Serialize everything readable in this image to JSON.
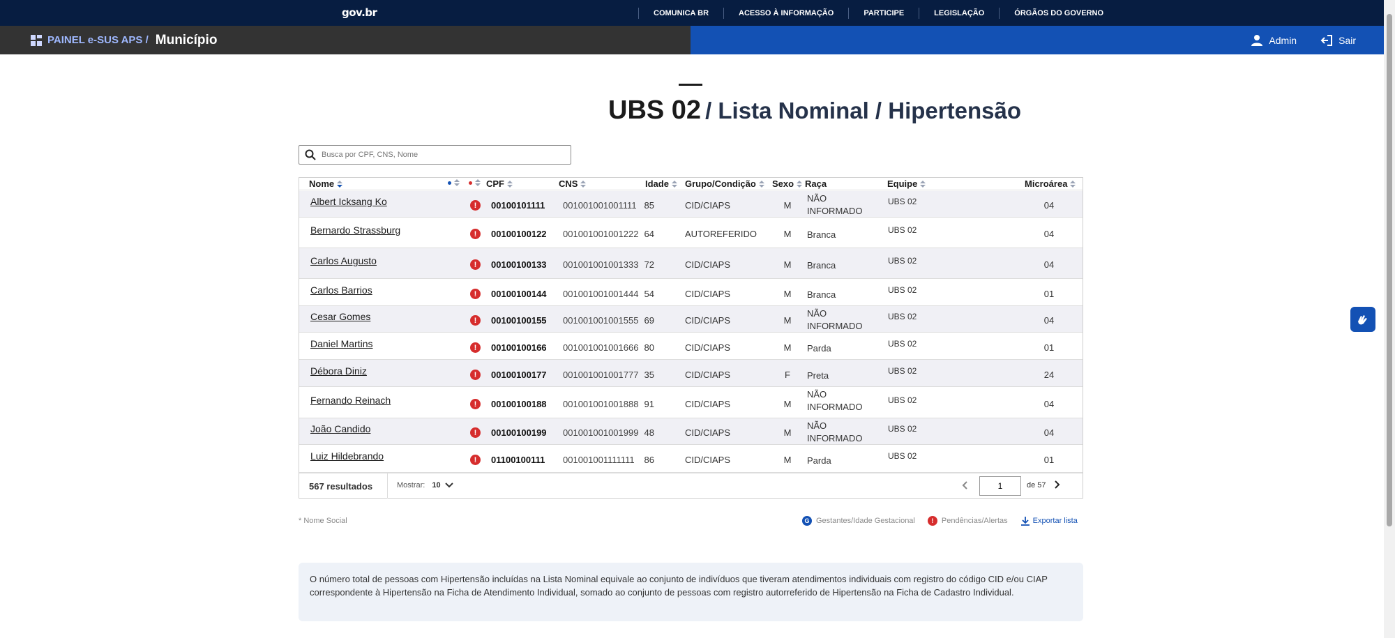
{
  "govbar": {
    "logo": "gov.br",
    "links": [
      "COMUNICA BR",
      "ACESSO À INFORMAÇÃO",
      "PARTICIPE",
      "LEGISLAÇÃO",
      "ÓRGÃOS DO GOVERNO"
    ]
  },
  "header": {
    "brand": "PAINEL e-SUS APS /",
    "city": "Município",
    "user_label": "Admin",
    "logout_label": "Sair"
  },
  "title": {
    "unit": "UBS 02",
    "subtitle": "/ Lista Nominal / Hipertensão"
  },
  "search": {
    "placeholder": "Busca por CPF, CNS, Nome"
  },
  "table": {
    "columns": {
      "name": "Nome",
      "cpf": "CPF",
      "cns": "CNS",
      "age": "Idade",
      "group": "Grupo/Condição",
      "sex": "Sexo",
      "race": "Raça",
      "team": "Equipe",
      "micro": "Microárea"
    },
    "alert_glyph": "!",
    "rows": [
      {
        "name": "Albert Icksang Ko",
        "cpf": "00100101111",
        "cns": "001001001001111",
        "age": "85",
        "group": "CID/CIAPS",
        "sex": "M",
        "race": "NÃO INFORMADO",
        "team": "UBS 02",
        "micro": "04"
      },
      {
        "name": "Bernardo Strassburg",
        "cpf": "00100100122",
        "cns": "001001001001222",
        "age": "64",
        "group": "AUTOREFERIDO",
        "sex": "M",
        "race": "Branca",
        "team": "UBS 02",
        "micro": "04"
      },
      {
        "name": "Carlos Augusto",
        "cpf": "00100100133",
        "cns": "001001001001333",
        "age": "72",
        "group": "CID/CIAPS",
        "sex": "M",
        "race": "Branca",
        "team": "UBS 02",
        "micro": "04"
      },
      {
        "name": "Carlos Barrios",
        "cpf": "00100100144",
        "cns": "001001001001444",
        "age": "54",
        "group": "CID/CIAPS",
        "sex": "M",
        "race": "Branca",
        "team": "UBS 02",
        "micro": "01"
      },
      {
        "name": "Cesar Gomes",
        "cpf": "00100100155",
        "cns": "001001001001555",
        "age": "69",
        "group": "CID/CIAPS",
        "sex": "M",
        "race": "NÃO INFORMADO",
        "team": "UBS 02",
        "micro": "04"
      },
      {
        "name": "Daniel Martins",
        "cpf": "00100100166",
        "cns": "001001001001666",
        "age": "80",
        "group": "CID/CIAPS",
        "sex": "M",
        "race": "Parda",
        "team": "UBS 02",
        "micro": "01"
      },
      {
        "name": "Débora Diniz",
        "cpf": "00100100177",
        "cns": "001001001001777",
        "age": "35",
        "group": "CID/CIAPS",
        "sex": "F",
        "race": "Preta",
        "team": "UBS 02",
        "micro": "24"
      },
      {
        "name": "Fernando Reinach",
        "cpf": "00100100188",
        "cns": "001001001001888",
        "age": "91",
        "group": "CID/CIAPS",
        "sex": "M",
        "race": "NÃO INFORMADO",
        "team": "UBS 02",
        "micro": "04"
      },
      {
        "name": "João Candido",
        "cpf": "00100100199",
        "cns": "001001001001999",
        "age": "48",
        "group": "CID/CIAPS",
        "sex": "M",
        "race": "NÃO INFORMADO",
        "team": "UBS 02",
        "micro": "04"
      },
      {
        "name": "Luiz Hildebrando",
        "cpf": "01100100111",
        "cns": "001001001111111",
        "age": "86",
        "group": "CID/CIAPS",
        "sex": "M",
        "race": "Parda",
        "team": "UBS 02",
        "micro": "01"
      }
    ]
  },
  "footer": {
    "results": "567 resultados",
    "show_label": "Mostrar:",
    "show_value": "10",
    "page_value": "1",
    "page_of": "de 57"
  },
  "legend": {
    "social_name": "* Nome Social",
    "pregnant_glyph": "G",
    "pregnant_label": "Gestantes/Idade Gestacional",
    "alert_glyph": "!",
    "alert_label": "Pendências/Alertas",
    "export_label": "Exportar lista"
  },
  "info_text": "O número total de pessoas com Hipertensão incluídas na Lista Nominal equivale ao conjunto de indivíduos que tiveram atendimentos individuais com registro do código CID e/ou CIAP correspondente à Hipertensão na Ficha de Atendimento Individual, somado ao conjunto de pessoas com registro autorreferido de Hipertensão na Ficha de Cadastro Individual.",
  "colors": {
    "gov_blue": "#071d41",
    "primary_blue": "#1351b4",
    "header_dark": "#333333",
    "alert_red": "#d62d2d",
    "row_alt": "#f0f0f5"
  }
}
